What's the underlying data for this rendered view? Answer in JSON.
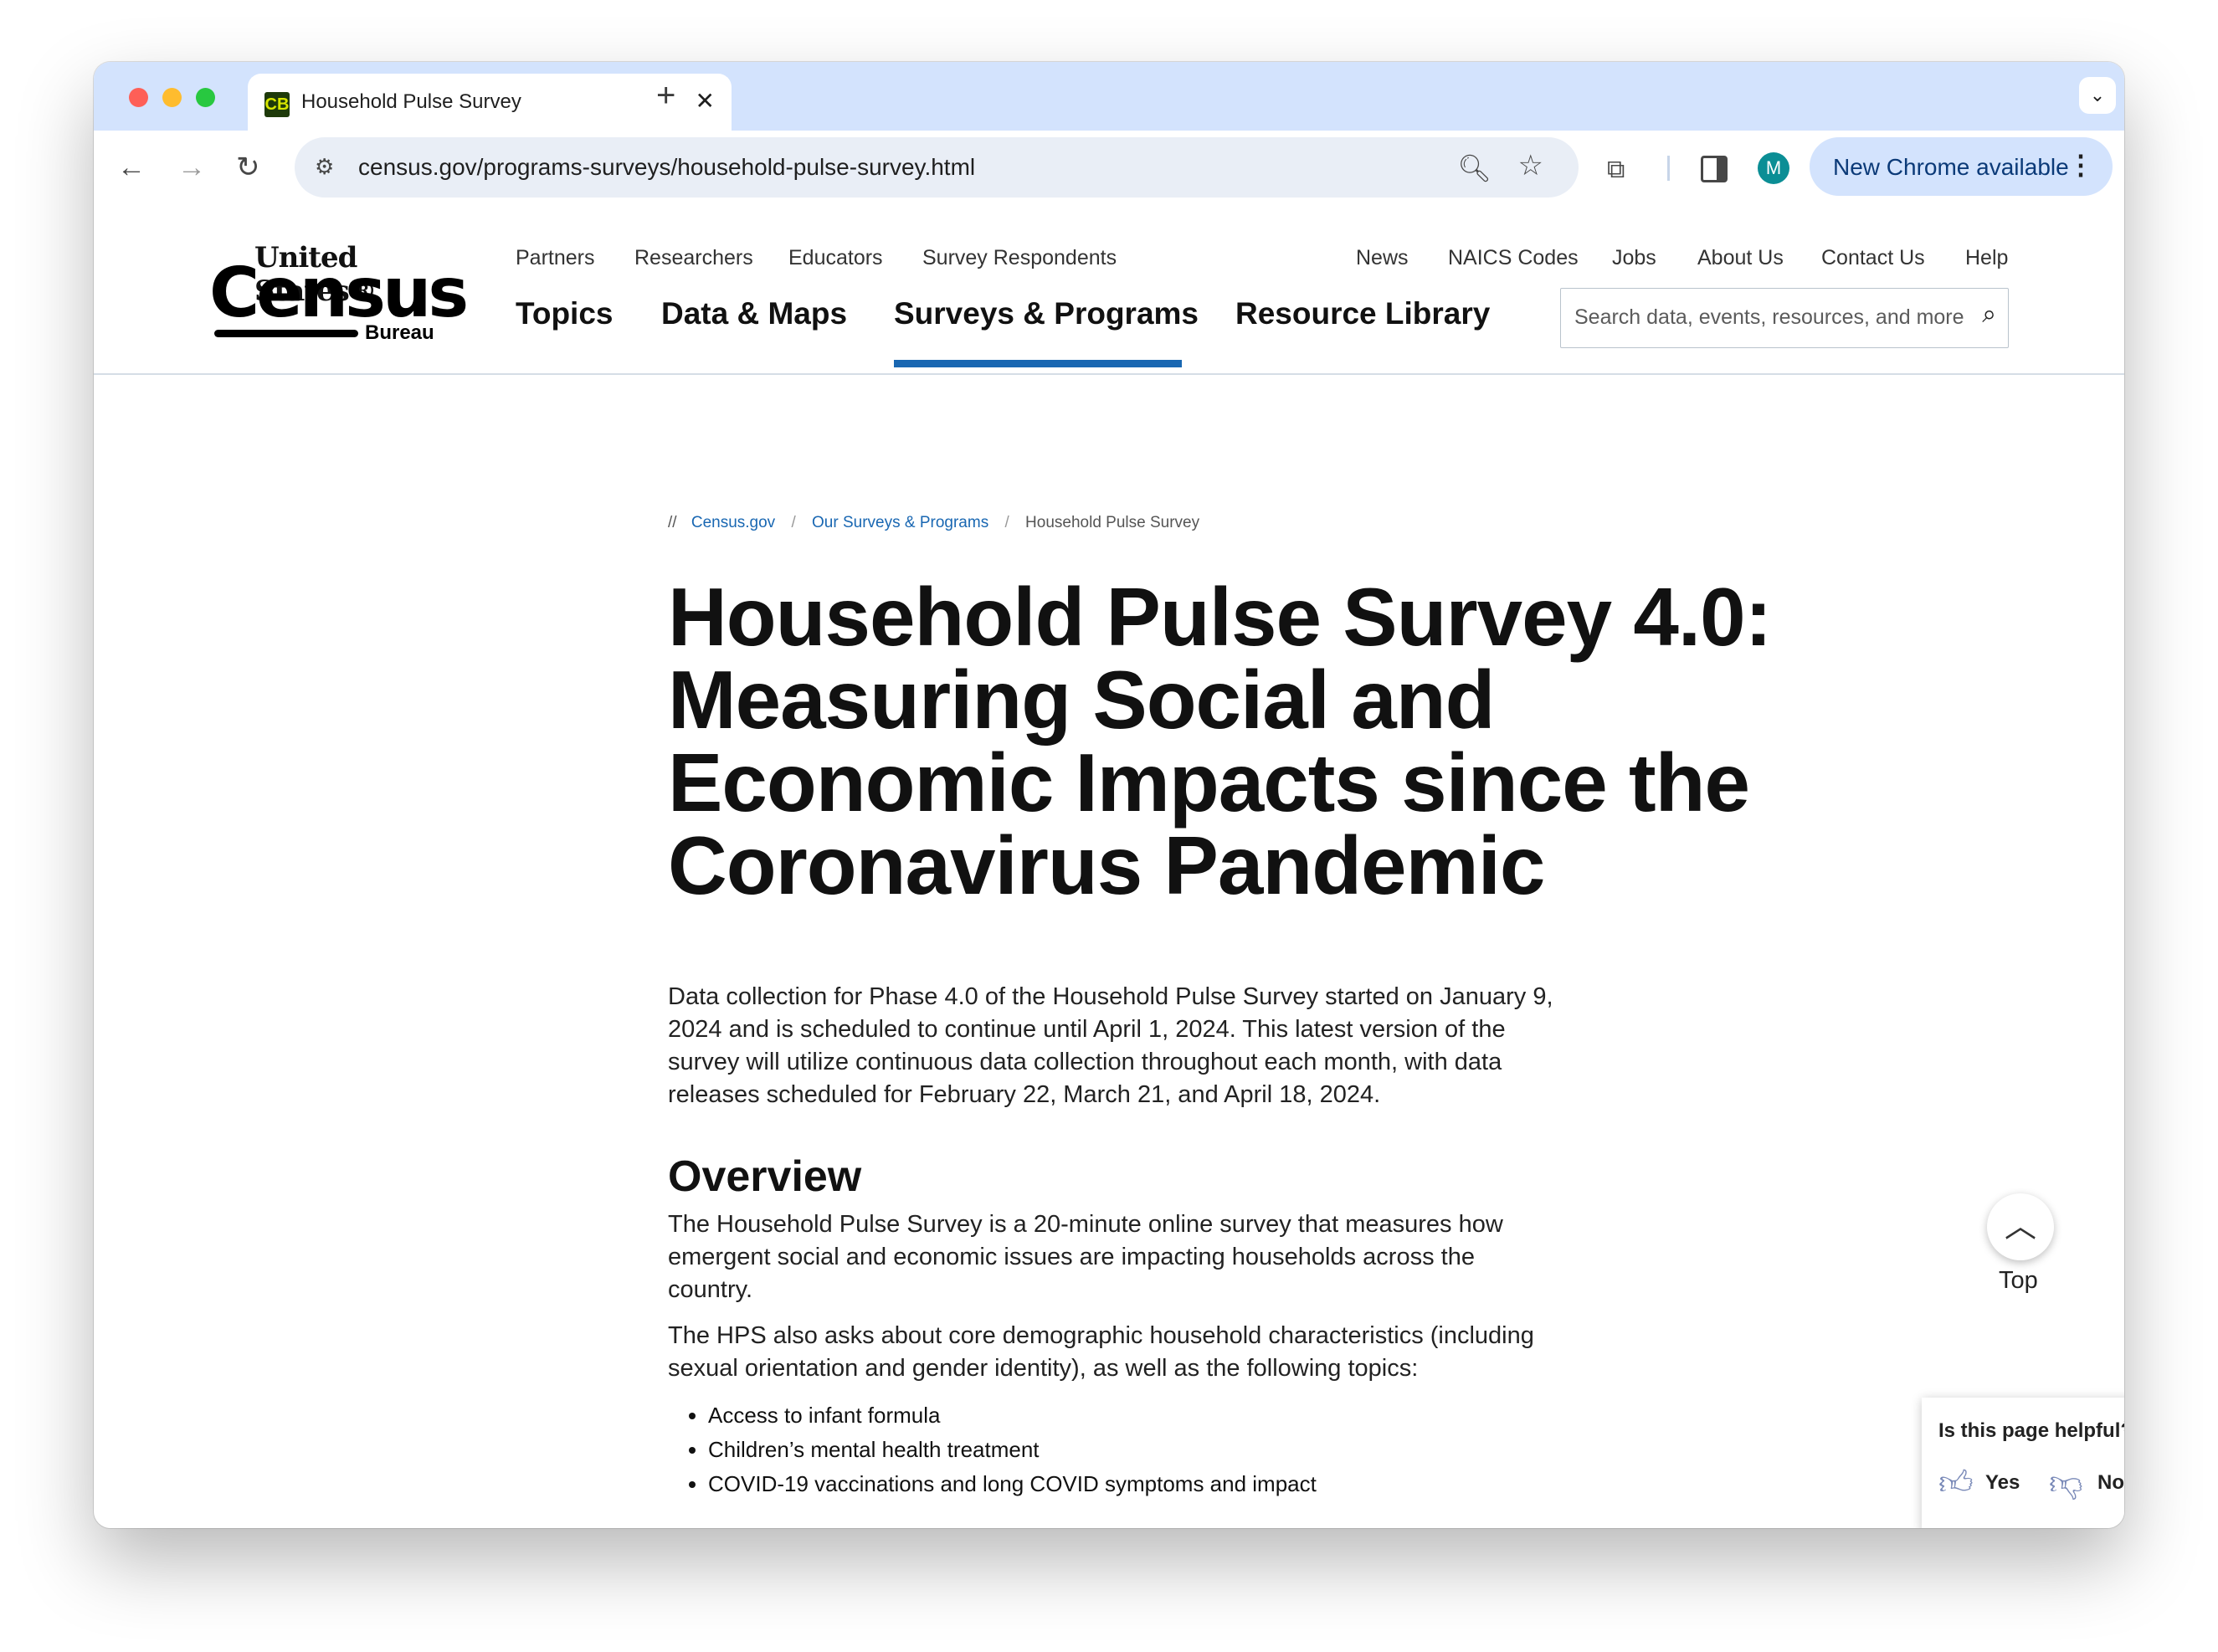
{
  "browser": {
    "tab_title": "Household Pulse Survey",
    "favicon_text": "CB",
    "url": "census.gov/programs-surveys/household-pulse-survey.html",
    "update_label": "New Chrome available",
    "avatar_letter": "M"
  },
  "header": {
    "logo": {
      "line1": "United States®",
      "line2": "Census",
      "line3": "Bureau"
    },
    "utility_left": [
      "Partners",
      "Researchers",
      "Educators",
      "Survey Respondents"
    ],
    "utility_right": [
      "News",
      "NAICS Codes",
      "Jobs",
      "About Us",
      "Contact Us",
      "Help"
    ],
    "main_nav": [
      "Topics",
      "Data & Maps",
      "Surveys & Programs",
      "Resource Library"
    ],
    "active_nav": "Surveys & Programs",
    "search_placeholder": "Search data, events, resources, and more"
  },
  "breadcrumb": {
    "prefix": "//",
    "items": [
      "Census.gov",
      "Our Surveys & Programs",
      "Household Pulse Survey"
    ]
  },
  "page": {
    "title": "Household Pulse Survey 4.0: Measuring Social and Economic Impacts since the Coronavirus Pandemic",
    "intro": "Data collection for Phase 4.0 of the Household Pulse Survey started on January 9, 2024 and is scheduled to continue until April 1, 2024. This latest version of the survey will utilize continuous data collection throughout each month, with data releases scheduled for February 22, March 21, and April 18, 2024.",
    "overview_heading": "Overview",
    "overview_p1": "The Household Pulse Survey is a 20-minute online survey that measures how emergent social and economic issues are impacting households across the country.",
    "overview_p2": "The HPS also asks about core demographic household characteristics (including sexual orientation and gender identity), as well as the following topics:",
    "topics": [
      "Access to infant formula",
      "Children’s mental health treatment",
      "COVID-19 vaccinations and long COVID symptoms and impact"
    ]
  },
  "back_to_top": {
    "label": "Top"
  },
  "feedback": {
    "question": "Is this page helpful?",
    "yes": "Yes",
    "no": "No"
  },
  "colors": {
    "link": "#1967b2",
    "nav_underline": "#1967b2",
    "tabstrip": "#d3e3fd"
  }
}
